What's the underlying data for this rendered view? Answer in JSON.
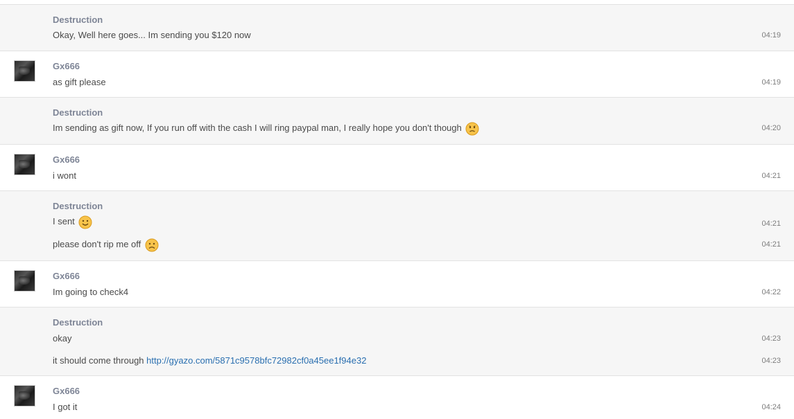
{
  "messages": [
    {
      "author": "Destruction",
      "lines": [
        {
          "text": "Okay, Well here goes... Im sending you $120 now",
          "time": "04:19"
        }
      ]
    },
    {
      "author": "Gx666",
      "lines": [
        {
          "text": "as gift please",
          "time": "04:19"
        }
      ]
    },
    {
      "author": "Destruction",
      "lines": [
        {
          "text": "Im sending as gift now, If you run off with the cash I will ring paypal man, I really hope you don't though",
          "time": "04:20",
          "emoji": "worried-face-icon"
        }
      ]
    },
    {
      "author": "Gx666",
      "lines": [
        {
          "text": "i wont",
          "time": "04:21"
        }
      ]
    },
    {
      "author": "Destruction",
      "lines": [
        {
          "text": "I sent",
          "time": "04:21",
          "emoji": "smiley-face-icon"
        },
        {
          "text": "please don't rip me off",
          "time": "04:21",
          "emoji": "frowning-face-icon"
        }
      ]
    },
    {
      "author": "Gx666",
      "lines": [
        {
          "text": "Im going to check4",
          "time": "04:22"
        }
      ]
    },
    {
      "author": "Destruction",
      "lines": [
        {
          "text": "okay",
          "time": "04:23"
        },
        {
          "text": "it should come through ",
          "link": "http://gyazo.com/5871c9578bfc72982cf0a45ee1f94e32",
          "time": "04:23"
        }
      ]
    },
    {
      "author": "Gx666",
      "lines": [
        {
          "text": "I got it",
          "time": "04:24"
        }
      ]
    }
  ],
  "colors": {
    "author": "#7e8596",
    "link": "#2a6fb0",
    "alt_row_bg": "#f6f6f6"
  }
}
